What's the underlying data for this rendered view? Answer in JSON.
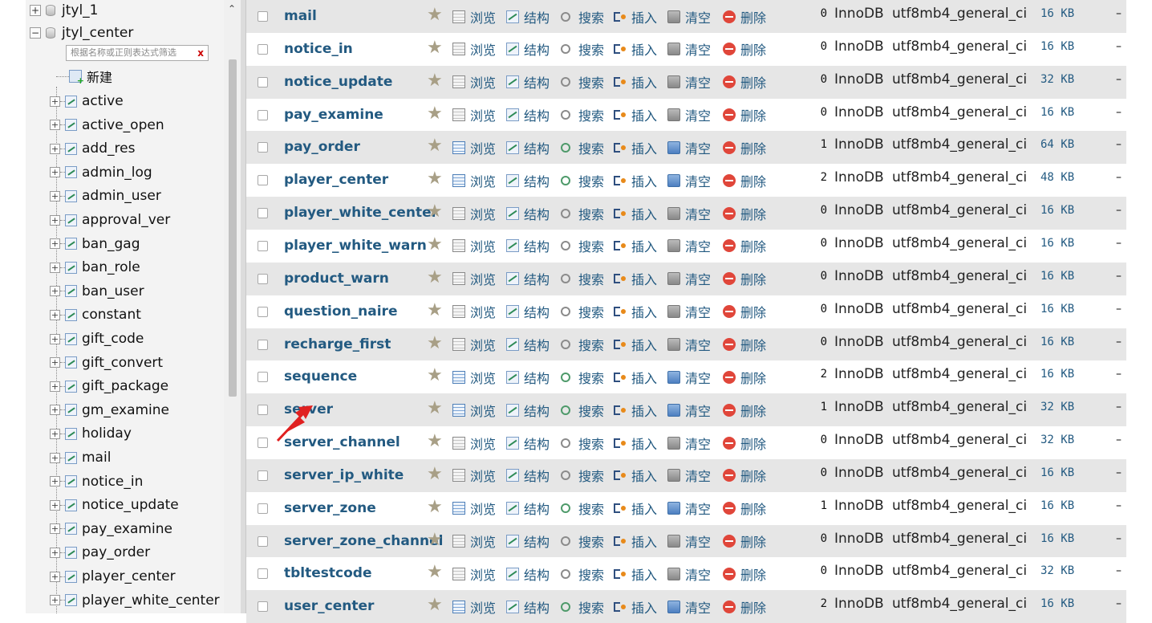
{
  "nav": {
    "databases": [
      {
        "name": "jtyl_1",
        "toggle": "+"
      },
      {
        "name": "jtyl_center",
        "toggle": "−"
      }
    ],
    "filter_placeholder": "根据名称或正则表达式筛选",
    "filter_clear": "x",
    "new_label": "新建",
    "tables": [
      "active",
      "active_open",
      "add_res",
      "admin_log",
      "admin_user",
      "approval_ver",
      "ban_gag",
      "ban_role",
      "ban_user",
      "constant",
      "gift_code",
      "gift_convert",
      "gift_package",
      "gm_examine",
      "holiday",
      "mail",
      "notice_in",
      "notice_update",
      "pay_examine",
      "pay_order",
      "player_center",
      "player_white_center"
    ],
    "scroll_up": "⌃"
  },
  "actions": {
    "browse": "浏览",
    "structure": "结构",
    "search": "搜索",
    "insert": "插入",
    "empty": "清空",
    "drop": "删除"
  },
  "icons": {
    "star": "star-icon",
    "browse": "table-browse-icon",
    "structure": "structure-icon",
    "search": "search-icon",
    "insert": "insert-icon",
    "empty": "empty-icon",
    "drop": "drop-icon"
  },
  "colors": {
    "link": "#235a81",
    "row_alt": "#e6e6e6",
    "drop": "#e0463a"
  },
  "table_rows": [
    {
      "name": "mail",
      "rows": "0",
      "engine": "InnoDB",
      "collation": "utf8mb4_general_ci",
      "size": "16 KB",
      "overhead": "–",
      "has_data": false
    },
    {
      "name": "notice_in",
      "rows": "0",
      "engine": "InnoDB",
      "collation": "utf8mb4_general_ci",
      "size": "16 KB",
      "overhead": "–",
      "has_data": false
    },
    {
      "name": "notice_update",
      "rows": "0",
      "engine": "InnoDB",
      "collation": "utf8mb4_general_ci",
      "size": "32 KB",
      "overhead": "–",
      "has_data": false
    },
    {
      "name": "pay_examine",
      "rows": "0",
      "engine": "InnoDB",
      "collation": "utf8mb4_general_ci",
      "size": "16 KB",
      "overhead": "–",
      "has_data": false
    },
    {
      "name": "pay_order",
      "rows": "1",
      "engine": "InnoDB",
      "collation": "utf8mb4_general_ci",
      "size": "64 KB",
      "overhead": "–",
      "has_data": true
    },
    {
      "name": "player_center",
      "rows": "2",
      "engine": "InnoDB",
      "collation": "utf8mb4_general_ci",
      "size": "48 KB",
      "overhead": "–",
      "has_data": true
    },
    {
      "name": "player_white_center",
      "rows": "0",
      "engine": "InnoDB",
      "collation": "utf8mb4_general_ci",
      "size": "16 KB",
      "overhead": "–",
      "has_data": false
    },
    {
      "name": "player_white_warn",
      "rows": "0",
      "engine": "InnoDB",
      "collation": "utf8mb4_general_ci",
      "size": "16 KB",
      "overhead": "–",
      "has_data": false
    },
    {
      "name": "product_warn",
      "rows": "0",
      "engine": "InnoDB",
      "collation": "utf8mb4_general_ci",
      "size": "16 KB",
      "overhead": "–",
      "has_data": false
    },
    {
      "name": "question_naire",
      "rows": "0",
      "engine": "InnoDB",
      "collation": "utf8mb4_general_ci",
      "size": "16 KB",
      "overhead": "–",
      "has_data": false
    },
    {
      "name": "recharge_first",
      "rows": "0",
      "engine": "InnoDB",
      "collation": "utf8mb4_general_ci",
      "size": "16 KB",
      "overhead": "–",
      "has_data": false
    },
    {
      "name": "sequence",
      "rows": "2",
      "engine": "InnoDB",
      "collation": "utf8mb4_general_ci",
      "size": "16 KB",
      "overhead": "–",
      "has_data": true
    },
    {
      "name": "server",
      "rows": "1",
      "engine": "InnoDB",
      "collation": "utf8mb4_general_ci",
      "size": "32 KB",
      "overhead": "–",
      "has_data": true
    },
    {
      "name": "server_channel",
      "rows": "0",
      "engine": "InnoDB",
      "collation": "utf8mb4_general_ci",
      "size": "32 KB",
      "overhead": "–",
      "has_data": false
    },
    {
      "name": "server_ip_white",
      "rows": "0",
      "engine": "InnoDB",
      "collation": "utf8mb4_general_ci",
      "size": "16 KB",
      "overhead": "–",
      "has_data": false
    },
    {
      "name": "server_zone",
      "rows": "1",
      "engine": "InnoDB",
      "collation": "utf8mb4_general_ci",
      "size": "16 KB",
      "overhead": "–",
      "has_data": true
    },
    {
      "name": "server_zone_channel",
      "rows": "0",
      "engine": "InnoDB",
      "collation": "utf8mb4_general_ci",
      "size": "16 KB",
      "overhead": "–",
      "has_data": false
    },
    {
      "name": "tbltestcode",
      "rows": "0",
      "engine": "InnoDB",
      "collation": "utf8mb4_general_ci",
      "size": "32 KB",
      "overhead": "–",
      "has_data": false
    },
    {
      "name": "user_center",
      "rows": "2",
      "engine": "InnoDB",
      "collation": "utf8mb4_general_ci",
      "size": "16 KB",
      "overhead": "–",
      "has_data": true
    }
  ]
}
